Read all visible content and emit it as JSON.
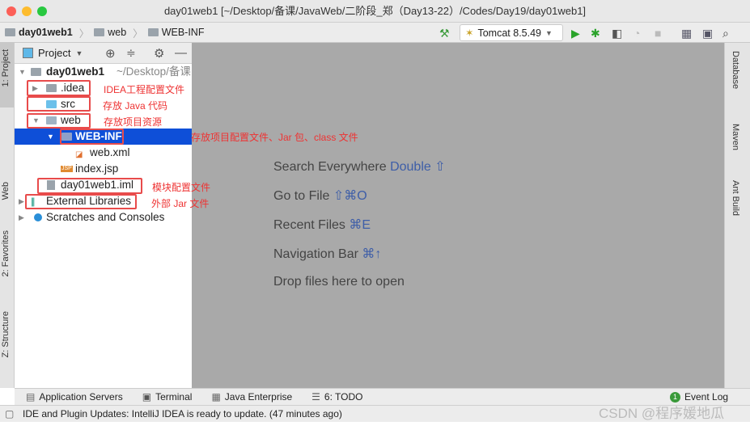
{
  "window": {
    "title": "day01web1 [~/Desktop/备课/JavaWeb/二阶段_郑（Day13-22）/Codes/Day19/day01web1]"
  },
  "breadcrumb": [
    "day01web1",
    "web",
    "WEB-INF"
  ],
  "toolbar": {
    "run_config": "Tomcat 8.5.49"
  },
  "left_stripe": {
    "project": "1: Project",
    "web": "Web",
    "favorites": "2: Favorites",
    "structure": "Z: Structure"
  },
  "project_panel": {
    "title": "Project"
  },
  "tree": [
    {
      "label": "day01web1",
      "suffix": "~/Desktop/备课"
    },
    {
      "label": ".idea",
      "annotation": "IDEA工程配置文件"
    },
    {
      "label": "src",
      "annotation": "存放 Java 代码"
    },
    {
      "label": "web",
      "annotation": "存放项目资源"
    },
    {
      "label": "WEB-INF",
      "annotation": "存放项目配置文件、Jar 包、class 文件"
    },
    {
      "label": "web.xml"
    },
    {
      "label": "index.jsp"
    },
    {
      "label": "day01web1.iml",
      "annotation": "模块配置文件"
    },
    {
      "label": "External Libraries",
      "annotation": "外部 Jar 文件"
    },
    {
      "label": "Scratches and Consoles"
    }
  ],
  "editor_hints": [
    {
      "text": "Search Everywhere",
      "key": "Double ⇧"
    },
    {
      "text": "Go to File",
      "key": "⇧⌘O"
    },
    {
      "text": "Recent Files",
      "key": "⌘E"
    },
    {
      "text": "Navigation Bar",
      "key": "⌘↑"
    },
    {
      "text": "Drop files here to open",
      "key": ""
    }
  ],
  "right_stripe": [
    "Database",
    "Maven",
    "Ant Build"
  ],
  "bottom_tools": [
    "Application Servers",
    "Terminal",
    "Java Enterprise",
    "6: TODO"
  ],
  "event_log": {
    "count": "1",
    "label": "Event Log"
  },
  "status": "IDE and Plugin Updates: IntelliJ IDEA is ready to update. (47 minutes ago)",
  "watermark": "CSDN @程序媛地瓜",
  "colors": {
    "selection": "#0e4fd8",
    "annotation": "#ee3333",
    "editor_bg": "#a9a9a9"
  }
}
